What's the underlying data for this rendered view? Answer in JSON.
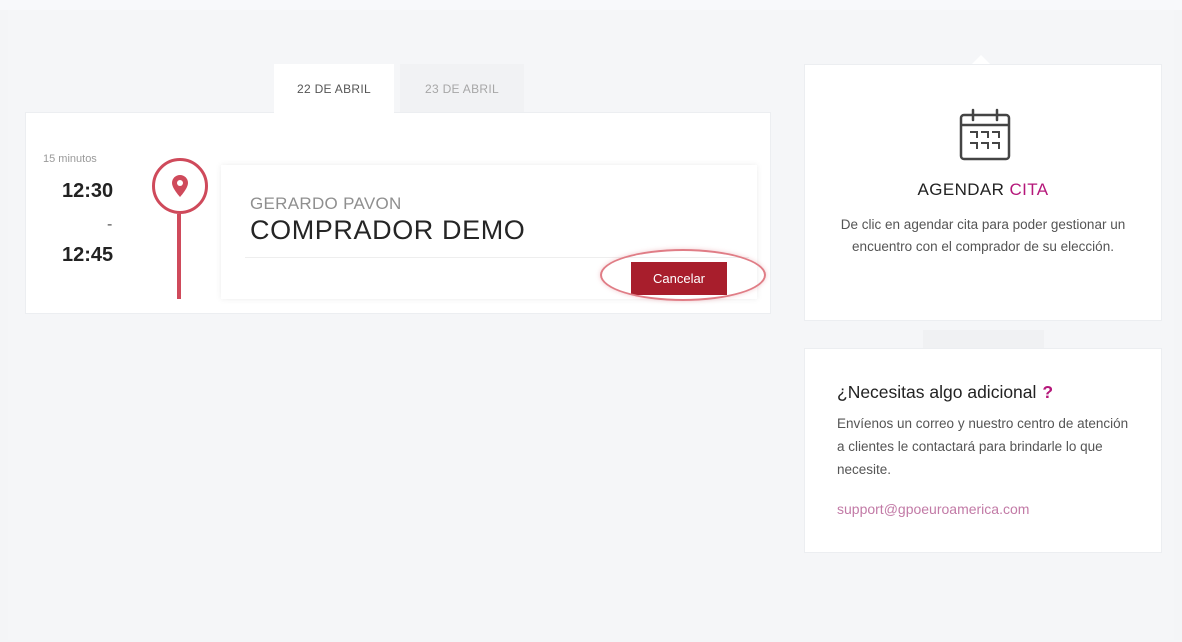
{
  "tabs": [
    {
      "label": "22 DE ABRIL",
      "active": true
    },
    {
      "label": "23 DE ABRIL",
      "active": false
    }
  ],
  "appointment": {
    "duration": "15 minutos",
    "start_time": "12:30",
    "separator": "-",
    "end_time": "12:45",
    "seller_name": "GERARDO PAVON",
    "buyer_name": "COMPRADOR DEMO",
    "cancel_label": "Cancelar"
  },
  "agenda": {
    "title_main": "AGENDAR ",
    "title_accent": "CITA",
    "description": "De clic en agendar cita para poder gestionar un encuentro con el comprador de su elección."
  },
  "help": {
    "title": "¿Necesitas algo adicional",
    "question_mark": "?",
    "text": "Envíenos un correo y nuestro centro de atención a clientes le contactará para brindarle lo que necesite.",
    "email": "support@gpoeuroamerica.com"
  },
  "colors": {
    "brand_red": "#a81e2c",
    "pin_red": "#cf4a5b",
    "accent_magenta": "#b5177a",
    "link_pink": "#c27aa6"
  },
  "icons": [
    "location-pin-icon",
    "calendar-icon"
  ]
}
